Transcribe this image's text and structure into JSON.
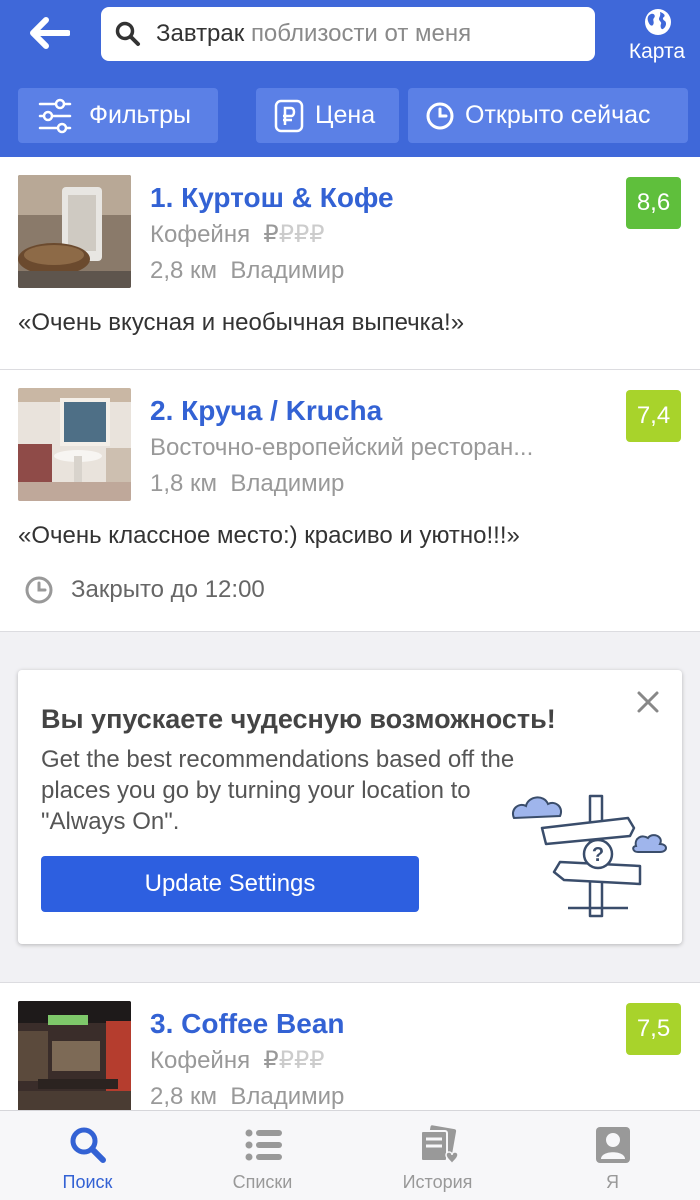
{
  "header": {
    "search_query": "Завтрак",
    "search_location": "поблизости от меня",
    "map_label": "Карта"
  },
  "filters": {
    "filters_label": "Фильтры",
    "price_label": "Цена",
    "open_now_label": "Открыто сейчас"
  },
  "venues": [
    {
      "name": "1. Куртош & Кофе",
      "category": "Кофейня",
      "price_active": "₽",
      "price_inactive": "₽₽₽",
      "distance": "2,8 км",
      "city": "Владимир",
      "rating": "8,6",
      "rating_color": "#5fbf3c",
      "tip": "«Очень вкусная и необычная выпечка!»"
    },
    {
      "name": "2. Круча / Krucha",
      "category": "Восточно-европейский ресторан...",
      "distance": "1,8 км",
      "city": "Владимир",
      "rating": "7,4",
      "rating_color": "#a8d32b",
      "tip": "«Очень классное место:) красиво и уютно!!!»",
      "hours": "Закрыто до 12:00"
    },
    {
      "name": "3. Coffee Bean",
      "category": "Кофейня",
      "price_active": "₽",
      "price_inactive": "₽₽₽",
      "distance": "2,8 км",
      "city": "Владимир",
      "rating": "7,5",
      "rating_color": "#a8d32b"
    }
  ],
  "promo": {
    "title": "Вы упускаете чудесную возможность!",
    "text": "Get the best recommendations based off the places you go by turning your location to \"Always On\".",
    "button_label": "Update Settings"
  },
  "tabbar": {
    "tabs": [
      {
        "label": "Поиск",
        "icon": "search-icon",
        "active": true
      },
      {
        "label": "Списки",
        "icon": "list-icon",
        "active": false
      },
      {
        "label": "История",
        "icon": "history-icon",
        "active": false
      },
      {
        "label": "Я",
        "icon": "profile-icon",
        "active": false
      }
    ]
  },
  "colors": {
    "header_bg": "#3f68d9",
    "chip_bg": "#5b80e6",
    "link_blue": "#3362d4",
    "button_blue": "#2d5fe0"
  }
}
